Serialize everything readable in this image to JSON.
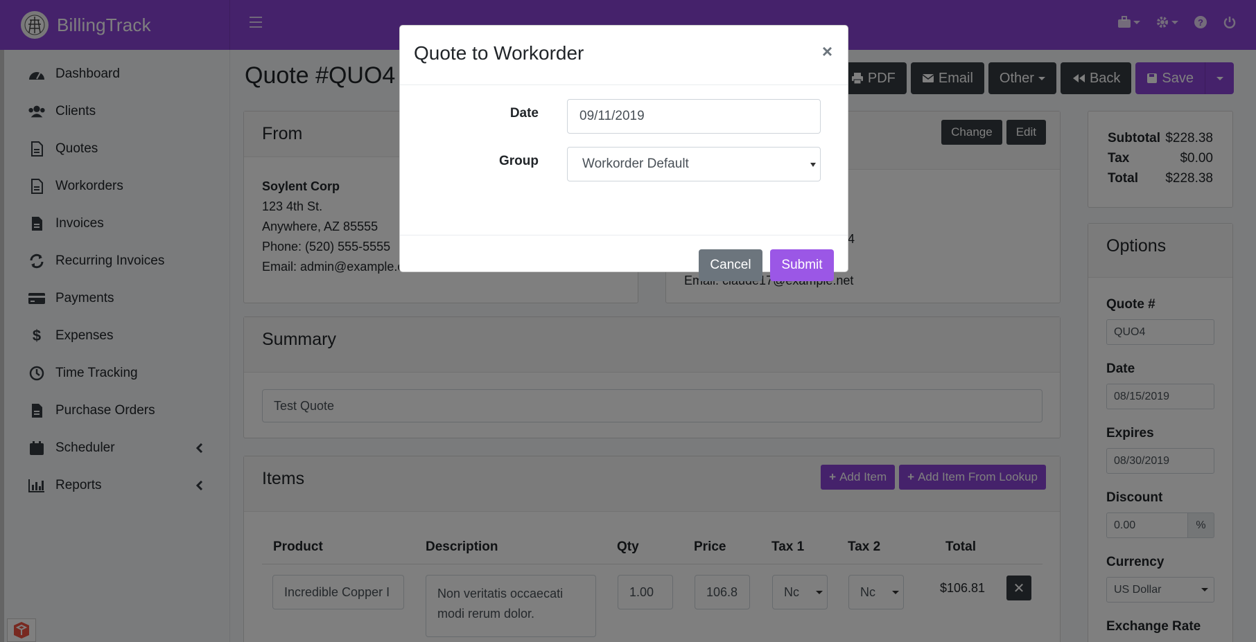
{
  "app": {
    "name": "BillingTrack"
  },
  "sidebar": {
    "items": [
      {
        "label": "Dashboard",
        "icon": "dashboard-icon"
      },
      {
        "label": "Clients",
        "icon": "users-icon"
      },
      {
        "label": "Quotes",
        "icon": "file-icon"
      },
      {
        "label": "Workorders",
        "icon": "file-icon"
      },
      {
        "label": "Invoices",
        "icon": "file-icon"
      },
      {
        "label": "Recurring Invoices",
        "icon": "sync-icon"
      },
      {
        "label": "Payments",
        "icon": "credit-card-icon"
      },
      {
        "label": "Expenses",
        "icon": "dollar-icon"
      },
      {
        "label": "Time Tracking",
        "icon": "clock-icon"
      },
      {
        "label": "Purchase Orders",
        "icon": "file-icon"
      },
      {
        "label": "Scheduler",
        "icon": "calendar-icon"
      },
      {
        "label": "Reports",
        "icon": "bar-chart-icon"
      }
    ]
  },
  "page": {
    "title": "Quote #QUO4"
  },
  "toolbar": {
    "pdf": "PDF",
    "email": "Email",
    "other": "Other",
    "back": "Back",
    "save": "Save"
  },
  "from": {
    "heading": "From",
    "company": "Soylent Corp",
    "address1": "123 4th St.",
    "address2": "Anywhere, AZ 85555",
    "phone": "Phone: (520) 555-5555",
    "email": "Email: admin@example.com"
  },
  "to": {
    "change": "Change",
    "edit": "Edit",
    "phone_partial": "4",
    "email": "Email: claude17@example.net"
  },
  "summary": {
    "heading": "Summary",
    "value": "Test Quote"
  },
  "items": {
    "heading": "Items",
    "add_item": "Add Item",
    "add_item_lookup": "Add Item From Lookup",
    "columns": [
      "Product",
      "Description",
      "Qty",
      "Price",
      "Tax 1",
      "Tax 2",
      "Total"
    ],
    "rows": [
      {
        "product": "Incredible Copper I",
        "description": "Non veritatis occaecati modi rerum dolor.",
        "qty": "1.00",
        "price": "106.8",
        "tax1": "Nc",
        "tax2": "Nc",
        "total": "$106.81"
      }
    ]
  },
  "totals": {
    "subtotal_label": "Subtotal",
    "subtotal": "$228.38",
    "tax_label": "Tax",
    "tax": "$0.00",
    "total_label": "Total",
    "total": "$228.38"
  },
  "options": {
    "heading": "Options",
    "quote_label": "Quote #",
    "quote_value": "QUO4",
    "date_label": "Date",
    "date_value": "08/15/2019",
    "expires_label": "Expires",
    "expires_value": "08/30/2019",
    "discount_label": "Discount",
    "discount_value": "0.00",
    "discount_unit": "%",
    "currency_label": "Currency",
    "currency_value": "US Dollar",
    "next_label_partial": "Exchange Rate"
  },
  "modal": {
    "title": "Quote to Workorder",
    "close": "×",
    "date_label": "Date",
    "date_value": "09/11/2019",
    "group_label": "Group",
    "group_value": "Workorder Default",
    "cancel": "Cancel",
    "submit": "Submit"
  },
  "colors": {
    "brand": "#8b44d6",
    "dark_button": "#343a40",
    "cancel_button": "#6c757d",
    "submit_button": "#9b57e6"
  }
}
